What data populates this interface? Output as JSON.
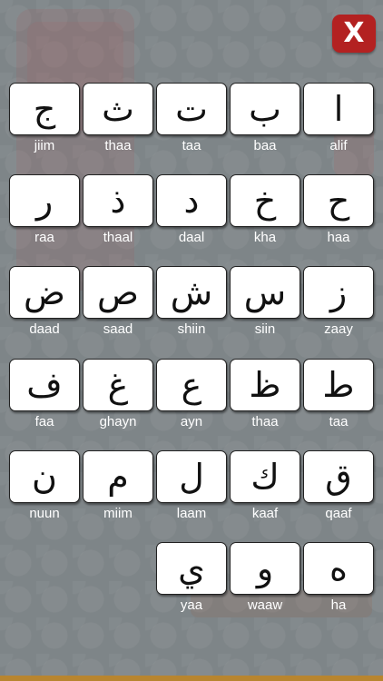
{
  "close_button": {
    "label": "X",
    "icon": "close-icon",
    "color": "#b32121"
  },
  "rows": [
    [
      {
        "letter": "ج",
        "name": "jiim"
      },
      {
        "letter": "ث",
        "name": "thaa"
      },
      {
        "letter": "ت",
        "name": "taa"
      },
      {
        "letter": "ب",
        "name": "baa"
      },
      {
        "letter": "ا",
        "name": "alif"
      }
    ],
    [
      {
        "letter": "ر",
        "name": "raa"
      },
      {
        "letter": "ذ",
        "name": "thaal"
      },
      {
        "letter": "د",
        "name": "daal"
      },
      {
        "letter": "خ",
        "name": "kha"
      },
      {
        "letter": "ح",
        "name": "haa"
      }
    ],
    [
      {
        "letter": "ض",
        "name": "daad"
      },
      {
        "letter": "ص",
        "name": "saad"
      },
      {
        "letter": "ش",
        "name": "shiin"
      },
      {
        "letter": "س",
        "name": "siin"
      },
      {
        "letter": "ز",
        "name": "zaay"
      }
    ],
    [
      {
        "letter": "ف",
        "name": "faa"
      },
      {
        "letter": "غ",
        "name": "ghayn"
      },
      {
        "letter": "ع",
        "name": "ayn"
      },
      {
        "letter": "ظ",
        "name": "thaa"
      },
      {
        "letter": "ط",
        "name": "taa"
      }
    ],
    [
      {
        "letter": "ن",
        "name": "nuun"
      },
      {
        "letter": "م",
        "name": "miim"
      },
      {
        "letter": "ل",
        "name": "laam"
      },
      {
        "letter": "ك",
        "name": "kaaf"
      },
      {
        "letter": "ق",
        "name": "qaaf"
      }
    ],
    [
      {
        "letter": "ي",
        "name": "yaa"
      },
      {
        "letter": "و",
        "name": "waaw"
      },
      {
        "letter": "ه",
        "name": "ha"
      }
    ]
  ]
}
